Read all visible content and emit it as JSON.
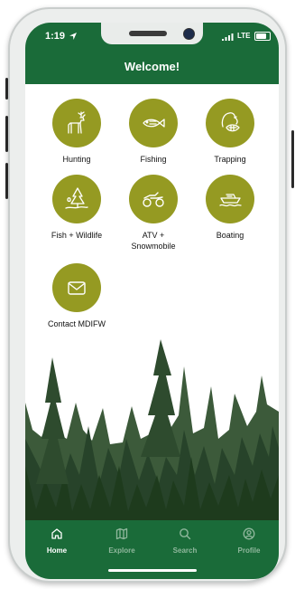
{
  "status_bar": {
    "time": "1:19",
    "network": "LTE"
  },
  "header": {
    "title": "Welcome!"
  },
  "tiles": [
    {
      "label": "Hunting",
      "icon": "deer-icon"
    },
    {
      "label": "Fishing",
      "icon": "fish-icon"
    },
    {
      "label": "Trapping",
      "icon": "beaver-icon"
    },
    {
      "label": "Fish + Wildlife",
      "icon": "wildlife-tree-icon"
    },
    {
      "label": "ATV +\nSnowmobile",
      "icon": "atv-icon"
    },
    {
      "label": "Boating",
      "icon": "boat-icon"
    },
    {
      "label": "Contact MDIFW",
      "icon": "mail-icon"
    }
  ],
  "tabs": [
    {
      "label": "Home",
      "icon": "home-icon",
      "active": true
    },
    {
      "label": "Explore",
      "icon": "map-icon",
      "active": false
    },
    {
      "label": "Search",
      "icon": "search-icon",
      "active": false
    },
    {
      "label": "Profile",
      "icon": "profile-icon",
      "active": false
    }
  ],
  "colors": {
    "brand_green": "#1a6b39",
    "icon_olive": "#959a22",
    "forest_dark": "#1e3b1d",
    "tab_inactive": "#8fb79c"
  }
}
